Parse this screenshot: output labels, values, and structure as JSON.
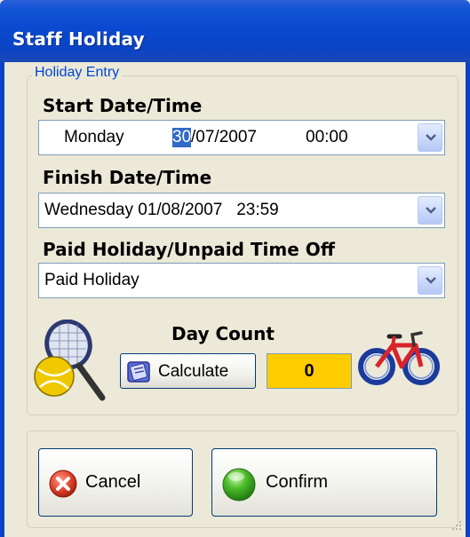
{
  "window": {
    "title": "Staff Holiday"
  },
  "holiday_entry": {
    "legend": "Holiday Entry",
    "start": {
      "label": "Start Date/Time",
      "day": "Monday",
      "date_selected": "30",
      "date_rest": "/07/2007",
      "time": "00:00"
    },
    "finish": {
      "label": "Finish Date/Time",
      "value": "Wednesday 01/08/2007   23:59"
    },
    "paid": {
      "label": "Paid Holiday/Unpaid Time Off",
      "value": "Paid Holiday"
    },
    "day_count": {
      "label": "Day Count",
      "calculate_label": "Calculate",
      "value": "0"
    }
  },
  "actions": {
    "cancel_label": "Cancel",
    "confirm_label": "Confirm"
  },
  "colors": {
    "titlebar": "#0b44c4",
    "legend": "#0046d5",
    "count_bg": "#ffcc00",
    "selection": "#316ac5"
  },
  "icons": [
    "tennis-racket-ball-icon",
    "dropdown-arrow-icon",
    "calculator-icon",
    "bicycle-icon",
    "cancel-x-icon",
    "confirm-green-circle-icon",
    "resize-grip-icon"
  ]
}
